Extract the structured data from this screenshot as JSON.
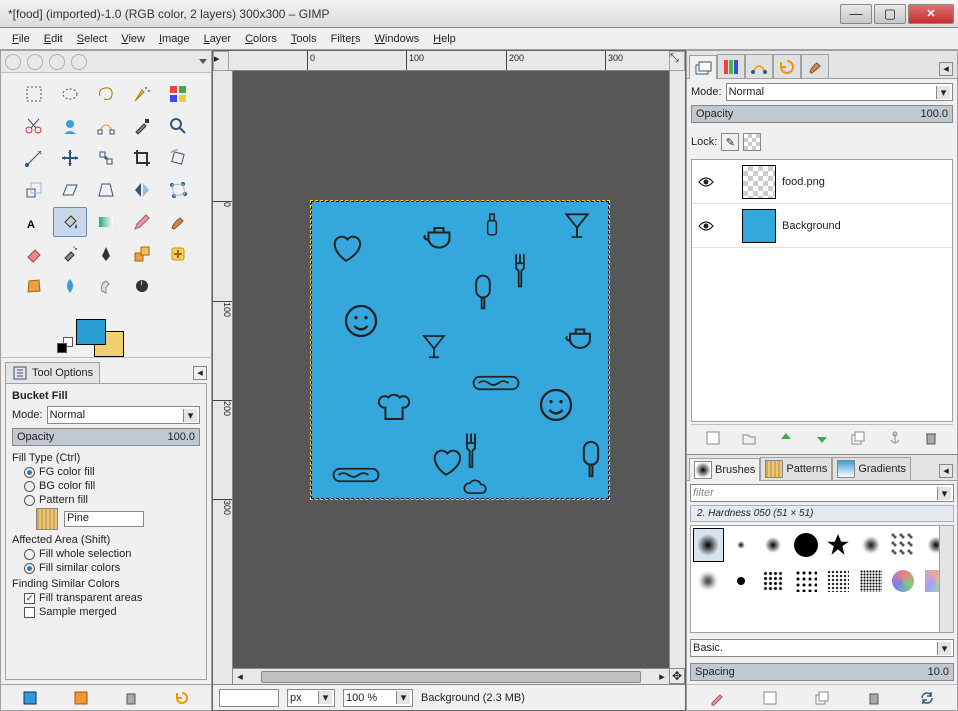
{
  "title": "*[food] (imported)-1.0 (RGB color, 2 layers) 300x300 – GIMP",
  "menu": [
    "File",
    "Edit",
    "Select",
    "View",
    "Image",
    "Layer",
    "Colors",
    "Tools",
    "Filters",
    "Windows",
    "Help"
  ],
  "tool_options": {
    "tab_label": "Tool Options",
    "title": "Bucket Fill",
    "mode_label": "Mode:",
    "mode_value": "Normal",
    "opacity_label": "Opacity",
    "opacity_value": "100.0",
    "fill_type_label": "Fill Type  (Ctrl)",
    "fg_fill": "FG color fill",
    "bg_fill": "BG color fill",
    "pattern_fill": "Pattern fill",
    "pattern_name": "Pine",
    "affected_label": "Affected Area  (Shift)",
    "fill_whole": "Fill whole selection",
    "fill_similar": "Fill similar colors",
    "finding_label": "Finding Similar Colors",
    "fill_transparent": "Fill transparent areas",
    "sample_merged": "Sample merged"
  },
  "canvas": {
    "ruler_ticks": [
      "0",
      "100",
      "200",
      "300"
    ],
    "unit": "px",
    "zoom": "100 %",
    "status_text": "Background (2.3 MB)"
  },
  "layers": {
    "mode_label": "Mode:",
    "mode_value": "Normal",
    "opacity_label": "Opacity",
    "opacity_value": "100.0",
    "lock_label": "Lock:",
    "items": [
      {
        "name": "food.png"
      },
      {
        "name": "Background"
      }
    ]
  },
  "brushes": {
    "tab_brushes": "Brushes",
    "tab_patterns": "Patterns",
    "tab_gradients": "Gradients",
    "filter_placeholder": "filter",
    "current": "2. Hardness 050 (51 × 51)",
    "preset_label": "Basic.",
    "spacing_label": "Spacing",
    "spacing_value": "10.0"
  },
  "colors": {
    "fg": "#2a9fd6",
    "bg": "#f0d070",
    "canvas_fill": "#34a7dd"
  }
}
